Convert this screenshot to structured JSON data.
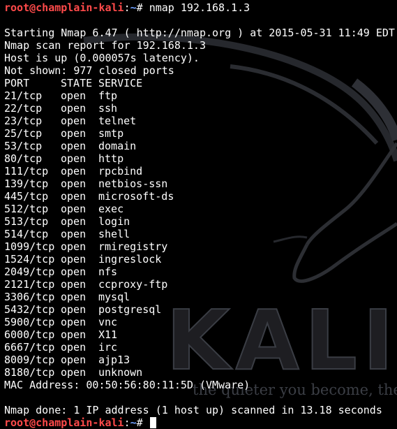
{
  "prompt": {
    "user_host": "root@champlain-kali",
    "separator": ":",
    "path": "~",
    "symbol": "# ",
    "command": "nmap 192.168.1.3"
  },
  "scan": {
    "start_line": "Starting Nmap 6.47 ( http://nmap.org ) at 2015-05-31 11:49 EDT",
    "report_line": "Nmap scan report for 192.168.1.3",
    "host_line": "Host is up (0.000057s latency).",
    "not_shown_line": "Not shown: 977 closed ports",
    "header": {
      "port": "PORT",
      "state": "STATE",
      "service": "SERVICE"
    },
    "ports": [
      {
        "port": "21/tcp",
        "state": "open",
        "service": "ftp"
      },
      {
        "port": "22/tcp",
        "state": "open",
        "service": "ssh"
      },
      {
        "port": "23/tcp",
        "state": "open",
        "service": "telnet"
      },
      {
        "port": "25/tcp",
        "state": "open",
        "service": "smtp"
      },
      {
        "port": "53/tcp",
        "state": "open",
        "service": "domain"
      },
      {
        "port": "80/tcp",
        "state": "open",
        "service": "http"
      },
      {
        "port": "111/tcp",
        "state": "open",
        "service": "rpcbind"
      },
      {
        "port": "139/tcp",
        "state": "open",
        "service": "netbios-ssn"
      },
      {
        "port": "445/tcp",
        "state": "open",
        "service": "microsoft-ds"
      },
      {
        "port": "512/tcp",
        "state": "open",
        "service": "exec"
      },
      {
        "port": "513/tcp",
        "state": "open",
        "service": "login"
      },
      {
        "port": "514/tcp",
        "state": "open",
        "service": "shell"
      },
      {
        "port": "1099/tcp",
        "state": "open",
        "service": "rmiregistry"
      },
      {
        "port": "1524/tcp",
        "state": "open",
        "service": "ingreslock"
      },
      {
        "port": "2049/tcp",
        "state": "open",
        "service": "nfs"
      },
      {
        "port": "2121/tcp",
        "state": "open",
        "service": "ccproxy-ftp"
      },
      {
        "port": "3306/tcp",
        "state": "open",
        "service": "mysql"
      },
      {
        "port": "5432/tcp",
        "state": "open",
        "service": "postgresql"
      },
      {
        "port": "5900/tcp",
        "state": "open",
        "service": "vnc"
      },
      {
        "port": "6000/tcp",
        "state": "open",
        "service": "X11"
      },
      {
        "port": "6667/tcp",
        "state": "open",
        "service": "irc"
      },
      {
        "port": "8009/tcp",
        "state": "open",
        "service": "ajp13"
      },
      {
        "port": "8180/tcp",
        "state": "open",
        "service": "unknown"
      }
    ],
    "mac_line": "MAC Address: 00:50:56:80:11:5D (VMware)",
    "done_line": "Nmap done: 1 IP address (1 host up) scanned in 13.18 seconds"
  },
  "wallpaper": {
    "logo_text": "KALI L",
    "tagline": "the quieter you become, the mo"
  },
  "colors": {
    "background": "#000000",
    "text": "#ffffff",
    "prompt_user": "#ff4a4a",
    "prompt_path": "#6fa0ff"
  }
}
